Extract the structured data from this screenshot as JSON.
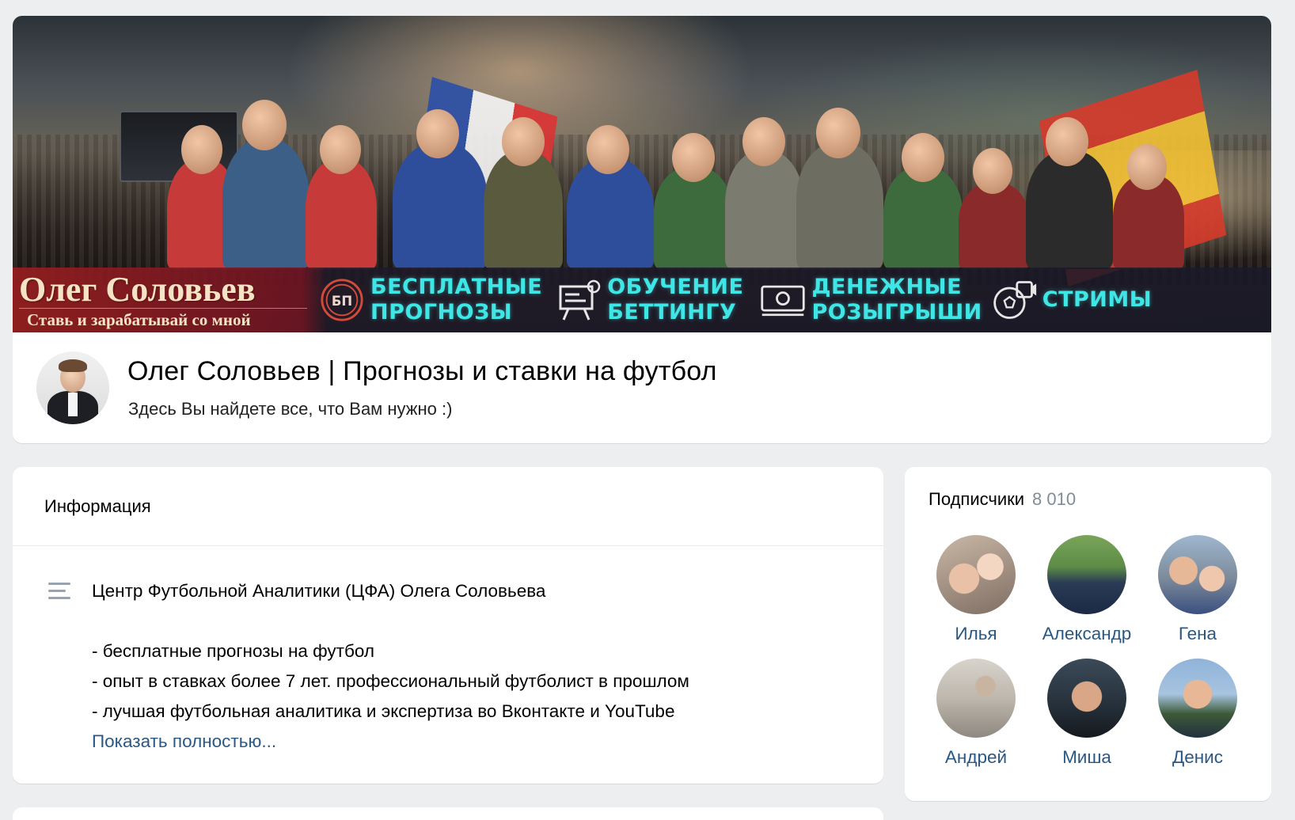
{
  "cover": {
    "brand_title": "Олег Соловьев",
    "brand_subtitle": "Ставь и зарабатывай со мной",
    "features": [
      {
        "icon": "bp-badge-icon",
        "badge": "БП",
        "text": "БЕСПЛАТНЫЕ\nПРОГНОЗЫ"
      },
      {
        "icon": "presentation-board-icon",
        "text": "ОБУЧЕНИЕ\nБЕТТИНГУ"
      },
      {
        "icon": "money-bill-icon",
        "text": "ДЕНЕЖНЫЕ\nРОЗЫГРЫШИ"
      },
      {
        "icon": "video-camera-ball-icon",
        "text": "СТРИМЫ"
      }
    ],
    "accent_color": "#3fe6e6"
  },
  "group": {
    "title": "Олег Соловьев | Прогнозы и ставки на футбол",
    "status": "Здесь Вы найдете все, что Вам нужно :)"
  },
  "info": {
    "header": "Информация",
    "description": [
      "Центр Футбольной Аналитики (ЦФА) Олега Соловьева",
      "",
      "- бесплатные прогнозы на футбол",
      "- опыт в ставках более 7 лет. профессиональный футболист в прошлом",
      "- лучшая футбольная аналитика и экспертиза во Вконтакте и YouTube"
    ],
    "show_more": "Показать полностью..."
  },
  "subscribers": {
    "label": "Подписчики",
    "count": "8 010",
    "members": [
      {
        "name": "Илья"
      },
      {
        "name": "Александр"
      },
      {
        "name": "Гена"
      },
      {
        "name": "Андрей"
      },
      {
        "name": "Миша"
      },
      {
        "name": "Денис"
      }
    ]
  },
  "colors": {
    "link": "#2a5885",
    "muted": "#818c99",
    "background": "#edeef0"
  }
}
